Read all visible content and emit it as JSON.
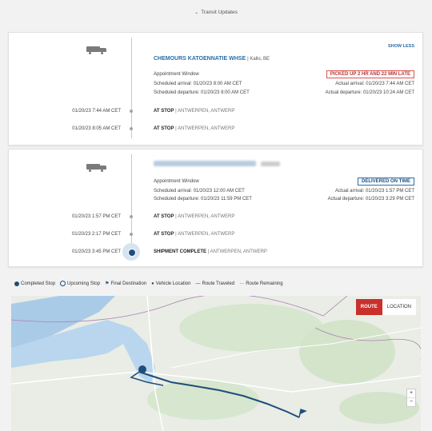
{
  "header": {
    "label": "Transit Updates"
  },
  "card1": {
    "show_less": "SHOW LESS",
    "company": "CHEMOURS KATOENNATIE WHSE",
    "location": "Kallo, BE",
    "appointment": "Appointment Window",
    "sched_arrival": "Scheduled arrival: 01/20/23 8:00 AM CET",
    "sched_departure": "Scheduled departure: 01/20/23 8:00 AM CET",
    "status": "PICKED UP 2 HR AND 22 MIN LATE",
    "actual_arrival": "Actual arrival: 01/20/23 7:44 AM CET",
    "actual_departure": "Actual departure: 01/20/23 10:24 AM CET",
    "stops": [
      {
        "time": "01/20/23 7:44 AM CET",
        "label": "AT STOP",
        "place": "ANTWERPEN, ANTWERP"
      },
      {
        "time": "01/20/23 8:05 AM CET",
        "label": "AT STOP",
        "place": "ANTWERPEN, ANTWERP"
      }
    ]
  },
  "card2": {
    "appointment": "Appointment Window",
    "sched_arrival": "Scheduled arrival: 01/20/23 12:00 AM CET",
    "sched_departure": "Scheduled departure: 01/20/23 11:59 PM CET",
    "status": "DELIVERED ON TIME",
    "actual_arrival": "Actual arrival: 01/20/23 1:57 PM CET",
    "actual_departure": "Actual departure: 01/20/23 3:29 PM CET",
    "stops": [
      {
        "time": "01/20/23 1:57 PM CET",
        "label": "AT STOP",
        "place": "ANTWERPEN, ANTWERP"
      },
      {
        "time": "01/20/23 2:17 PM CET",
        "label": "AT STOP",
        "place": "ANTWERPEN, ANTWERP"
      },
      {
        "time": "01/20/23 3:45 PM CET",
        "label": "SHIPMENT COMPLETE",
        "place": "ANTWERPEN, ANTWERP"
      }
    ]
  },
  "legend": {
    "completed": "Completed Stop",
    "upcoming": "Upcoming Stop",
    "final": "Final Destination",
    "vehicle": "Vehicle Location",
    "traveled": "Route Traveled",
    "remaining": "Route Remaining"
  },
  "map": {
    "route_btn": "ROUTE",
    "location_btn": "LOCATION",
    "zoom_in": "+",
    "zoom_out": "−"
  },
  "colors": {
    "accent": "#2a6da8",
    "late": "#d9534f",
    "route": "#1f4e7a",
    "route_btn": "#c9302c"
  }
}
